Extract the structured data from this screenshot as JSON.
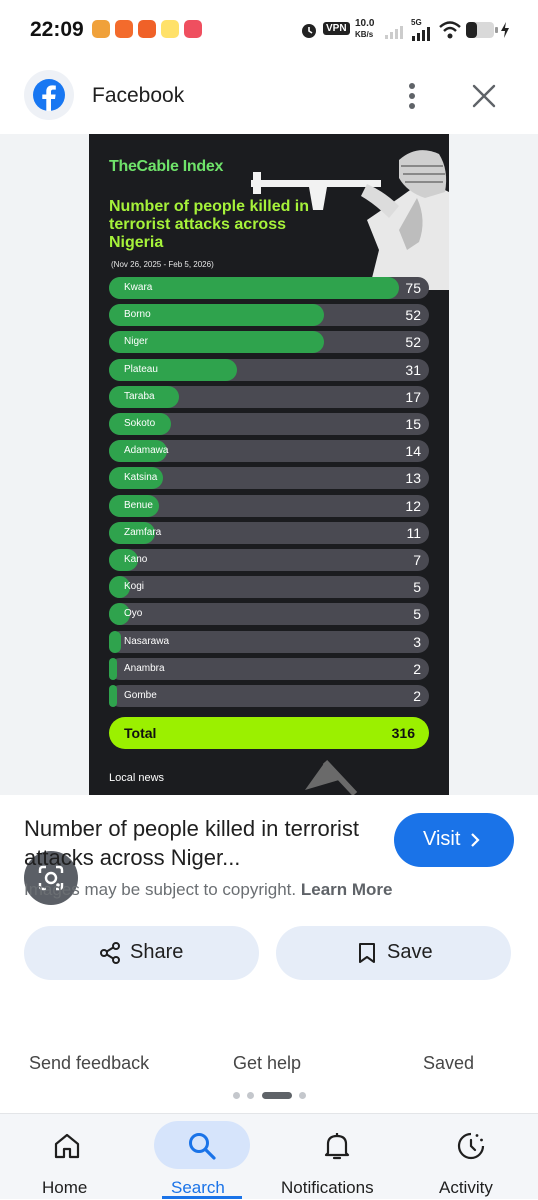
{
  "status_bar": {
    "time": "22:09",
    "vpn": "VPN",
    "net_speed": "10.0",
    "net_unit": "KB/s",
    "net_type": "5G"
  },
  "header": {
    "site_name": "Facebook",
    "site_icon": "facebook-logo",
    "more_icon": "more-vert-icon",
    "close_icon": "close-icon"
  },
  "infographic": {
    "brand": "TheCable Index",
    "title": "Number of people killed in terrorist attacks across Nigeria",
    "date_range": "(Nov 26, 2025 - Feb 5, 2026)",
    "footer": "Local news",
    "colors": {
      "background": "#1b1c1f",
      "bar_fill": "#2fa34d",
      "bar_track": "#4a4a52",
      "total": "#9bf000",
      "title": "#a6f23a"
    }
  },
  "chart_data": {
    "type": "bar",
    "orientation": "horizontal",
    "title": "Number of people killed in terrorist attacks across Nigeria",
    "subtitle": "(Nov 26, 2025 - Feb 5, 2026)",
    "categories": [
      "Kwara",
      "Borno",
      "Niger",
      "Plateau",
      "Taraba",
      "Sokoto",
      "Adamawa",
      "Katsina",
      "Benue",
      "Zamfara",
      "Kano",
      "Kogi",
      "Oyo",
      "Nasarawa",
      "Anambra",
      "Gombe"
    ],
    "values": [
      75,
      52,
      52,
      31,
      17,
      15,
      14,
      13,
      12,
      11,
      7,
      5,
      5,
      3,
      2,
      2
    ],
    "xlim": [
      0,
      75
    ],
    "total_label": "Total",
    "total_value": 316
  },
  "result": {
    "title": "Number of people killed in terrorist attacks across Niger...",
    "visit_label": "Visit",
    "copyright_text": "Images may be subject to copyright.",
    "learn_more": "Learn More",
    "share_label": "Share",
    "save_label": "Save"
  },
  "footer_links": {
    "feedback": "Send feedback",
    "help": "Get help",
    "saved": "Saved"
  },
  "bottom_nav": {
    "home": "Home",
    "search": "Search",
    "notifications": "Notifications",
    "activity": "Activity",
    "active": "search",
    "accent": "#1a73e8"
  }
}
